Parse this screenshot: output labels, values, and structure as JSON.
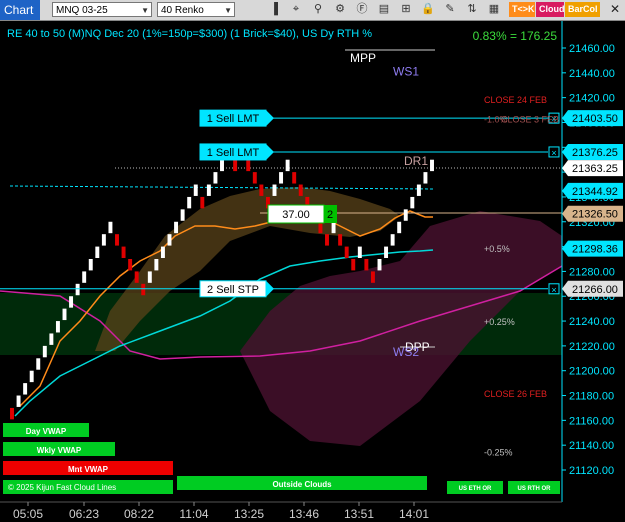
{
  "toolbar": {
    "title": "Chart",
    "instrument": "MNQ 03-25",
    "period": "40 Renko",
    "btn_tk": "T<>K",
    "btn_cloud": "Cloud",
    "btn_barcol": "BarCol",
    "colors": {
      "title_bg": "#1e63c6",
      "tk": "#ff8c1a",
      "cloud": "#d81b60",
      "barcol": "#f0a000"
    }
  },
  "chart_data": {
    "type": "candlestick",
    "title": "RE 40 to 50 (M)NQ Dec 20 (1%=150p=$300) (1 Brick=$40), US Dy RTH %",
    "pct_readout": "0.83% = 176.25",
    "y_ticks": [
      21460,
      21440,
      21420,
      21400,
      21380,
      21360,
      21340,
      21320,
      21300,
      21280,
      21260,
      21240,
      21220,
      21200,
      21180,
      21160,
      21140,
      21120
    ],
    "y_range": [
      21108,
      21477
    ],
    "x_ticks": [
      "05:05",
      "06:23",
      "08:22",
      "11:04",
      "13:25",
      "13:46",
      "13:51",
      "14:01"
    ],
    "bricks": [
      {
        "lo": 21160,
        "hi": 21170,
        "dir": "down"
      },
      {
        "lo": 21170,
        "hi": 21180,
        "dir": "up"
      },
      {
        "lo": 21180,
        "hi": 21190,
        "dir": "up"
      },
      {
        "lo": 21190,
        "hi": 21200,
        "dir": "up"
      },
      {
        "lo": 21200,
        "hi": 21210,
        "dir": "up"
      },
      {
        "lo": 21210,
        "hi": 21220,
        "dir": "up"
      },
      {
        "lo": 21220,
        "hi": 21230,
        "dir": "up"
      },
      {
        "lo": 21230,
        "hi": 21240,
        "dir": "up"
      },
      {
        "lo": 21240,
        "hi": 21250,
        "dir": "up"
      },
      {
        "lo": 21250,
        "hi": 21260,
        "dir": "up"
      },
      {
        "lo": 21260,
        "hi": 21270,
        "dir": "up"
      },
      {
        "lo": 21270,
        "hi": 21280,
        "dir": "up"
      },
      {
        "lo": 21280,
        "hi": 21290,
        "dir": "up"
      },
      {
        "lo": 21290,
        "hi": 21300,
        "dir": "up"
      },
      {
        "lo": 21300,
        "hi": 21310,
        "dir": "up"
      },
      {
        "lo": 21310,
        "hi": 21320,
        "dir": "up"
      },
      {
        "lo": 21300,
        "hi": 21310,
        "dir": "down"
      },
      {
        "lo": 21290,
        "hi": 21300,
        "dir": "down"
      },
      {
        "lo": 21280,
        "hi": 21290,
        "dir": "down"
      },
      {
        "lo": 21270,
        "hi": 21280,
        "dir": "down"
      },
      {
        "lo": 21260,
        "hi": 21270,
        "dir": "down"
      },
      {
        "lo": 21270,
        "hi": 21280,
        "dir": "up"
      },
      {
        "lo": 21280,
        "hi": 21290,
        "dir": "up"
      },
      {
        "lo": 21290,
        "hi": 21300,
        "dir": "up"
      },
      {
        "lo": 21300,
        "hi": 21310,
        "dir": "up"
      },
      {
        "lo": 21310,
        "hi": 21320,
        "dir": "up"
      },
      {
        "lo": 21320,
        "hi": 21330,
        "dir": "up"
      },
      {
        "lo": 21330,
        "hi": 21340,
        "dir": "up"
      },
      {
        "lo": 21340,
        "hi": 21350,
        "dir": "up"
      },
      {
        "lo": 21330,
        "hi": 21340,
        "dir": "down"
      },
      {
        "lo": 21340,
        "hi": 21350,
        "dir": "up"
      },
      {
        "lo": 21350,
        "hi": 21360,
        "dir": "up"
      },
      {
        "lo": 21360,
        "hi": 21370,
        "dir": "up"
      },
      {
        "lo": 21370,
        "hi": 21380,
        "dir": "up"
      },
      {
        "lo": 21360,
        "hi": 21370,
        "dir": "down"
      },
      {
        "lo": 21370,
        "hi": 21380,
        "dir": "up"
      },
      {
        "lo": 21360,
        "hi": 21370,
        "dir": "down"
      },
      {
        "lo": 21350,
        "hi": 21360,
        "dir": "down"
      },
      {
        "lo": 21340,
        "hi": 21350,
        "dir": "down"
      },
      {
        "lo": 21330,
        "hi": 21340,
        "dir": "down"
      },
      {
        "lo": 21340,
        "hi": 21350,
        "dir": "up"
      },
      {
        "lo": 21350,
        "hi": 21360,
        "dir": "up"
      },
      {
        "lo": 21360,
        "hi": 21370,
        "dir": "up"
      },
      {
        "lo": 21350,
        "hi": 21360,
        "dir": "down"
      },
      {
        "lo": 21340,
        "hi": 21350,
        "dir": "down"
      },
      {
        "lo": 21330,
        "hi": 21340,
        "dir": "down"
      },
      {
        "lo": 21320,
        "hi": 21330,
        "dir": "down"
      },
      {
        "lo": 21310,
        "hi": 21320,
        "dir": "down"
      },
      {
        "lo": 21300,
        "hi": 21310,
        "dir": "down"
      },
      {
        "lo": 21310,
        "hi": 21320,
        "dir": "up"
      },
      {
        "lo": 21300,
        "hi": 21310,
        "dir": "down"
      },
      {
        "lo": 21290,
        "hi": 21300,
        "dir": "down"
      },
      {
        "lo": 21280,
        "hi": 21290,
        "dir": "down"
      },
      {
        "lo": 21290,
        "hi": 21300,
        "dir": "up"
      },
      {
        "lo": 21280,
        "hi": 21290,
        "dir": "down"
      },
      {
        "lo": 21270,
        "hi": 21280,
        "dir": "down"
      },
      {
        "lo": 21280,
        "hi": 21290,
        "dir": "up"
      },
      {
        "lo": 21290,
        "hi": 21300,
        "dir": "up"
      },
      {
        "lo": 21300,
        "hi": 21310,
        "dir": "up"
      },
      {
        "lo": 21310,
        "hi": 21320,
        "dir": "up"
      },
      {
        "lo": 21320,
        "hi": 21330,
        "dir": "up"
      },
      {
        "lo": 21330,
        "hi": 21340,
        "dir": "up"
      },
      {
        "lo": 21340,
        "hi": 21350,
        "dir": "up"
      },
      {
        "lo": 21350,
        "hi": 21360,
        "dir": "up"
      },
      {
        "lo": 21360,
        "hi": 21370,
        "dir": "up"
      }
    ],
    "orders": [
      {
        "label": "1 Sell LMT",
        "price": 21403.5
      },
      {
        "label": "1 Sell LMT",
        "price": 21376.25
      },
      {
        "label": "2 Sell STP",
        "price": 21266.0
      }
    ],
    "price_tags": [
      {
        "price": 21403.5,
        "label": "21403.50",
        "bg": "#00e5ff",
        "fg": "#000"
      },
      {
        "price": 21376.25,
        "label": "21376.25",
        "bg": "#00e5ff",
        "fg": "#000"
      },
      {
        "price": 21363.25,
        "label": "21363.25",
        "bg": "#ffffff",
        "fg": "#000"
      },
      {
        "price": 21344.92,
        "label": "21344.92",
        "bg": "#00e5ff",
        "fg": "#000"
      },
      {
        "price": 21326.5,
        "label": "21326.50",
        "bg": "#d8b48c",
        "fg": "#000"
      },
      {
        "price": 21298.36,
        "label": "21298.36",
        "bg": "#00e5ff",
        "fg": "#000"
      },
      {
        "price": 21266.0,
        "label": "21266.00",
        "bg": "#e0e0e0",
        "fg": "#000"
      }
    ],
    "position": {
      "price_label": "37.00",
      "qty": "2"
    },
    "annotations": [
      {
        "text": "MPP",
        "price": 21452,
        "color": "#ffffff"
      },
      {
        "text": "WS1",
        "price": 21441,
        "color": "#8e7cf0"
      },
      {
        "text": "CLOSE 24 FEB",
        "price": 21419,
        "color": "#e02020"
      },
      {
        "text": "-1.0%",
        "price": 21403,
        "color": "#a05050"
      },
      {
        "text": "CLOSE 3 FEB",
        "price": 21403,
        "color": "#a05050"
      },
      {
        "text": "DR1",
        "price": 21369,
        "color": "#c8a0a0"
      },
      {
        "text": "+0.5%",
        "price": 21299,
        "color": "#c0c0c0"
      },
      {
        "text": "+0.25%",
        "price": 21240,
        "color": "#c0c0c0"
      },
      {
        "text": "DPP",
        "price": 21219,
        "color": "#ffffff"
      },
      {
        "text": "WS2",
        "price": 21215,
        "color": "#8e7cf0"
      },
      {
        "text": "CLOSE 26 FEB",
        "price": 21182,
        "color": "#e02020"
      },
      {
        "text": "-0.25%",
        "price": 21135,
        "color": "#c0c0c0"
      }
    ],
    "bottom_labels": {
      "day_vwap": "Day VWAP",
      "wkly_vwap": "Wkly VWAP",
      "mnt_vwap": "Mnt VWAP",
      "clouds": "© 2025 Kijun Fast Cloud Lines",
      "outside": "Outside Clouds",
      "eth": "US ETH OR",
      "rth": "US RTH OR"
    },
    "grid": false,
    "colors": {
      "up": "#ffffff",
      "down": "#e00000",
      "axis": "#00e5ff",
      "order": "#00e5ff",
      "cloud_pos": "#7a5a1c",
      "cloud_neg": "#5a1a40",
      "green_zone": "#003300",
      "tenkan": "#ff8c1a",
      "kijun": "#00d8d8",
      "pink_line": "#d020a0"
    }
  }
}
